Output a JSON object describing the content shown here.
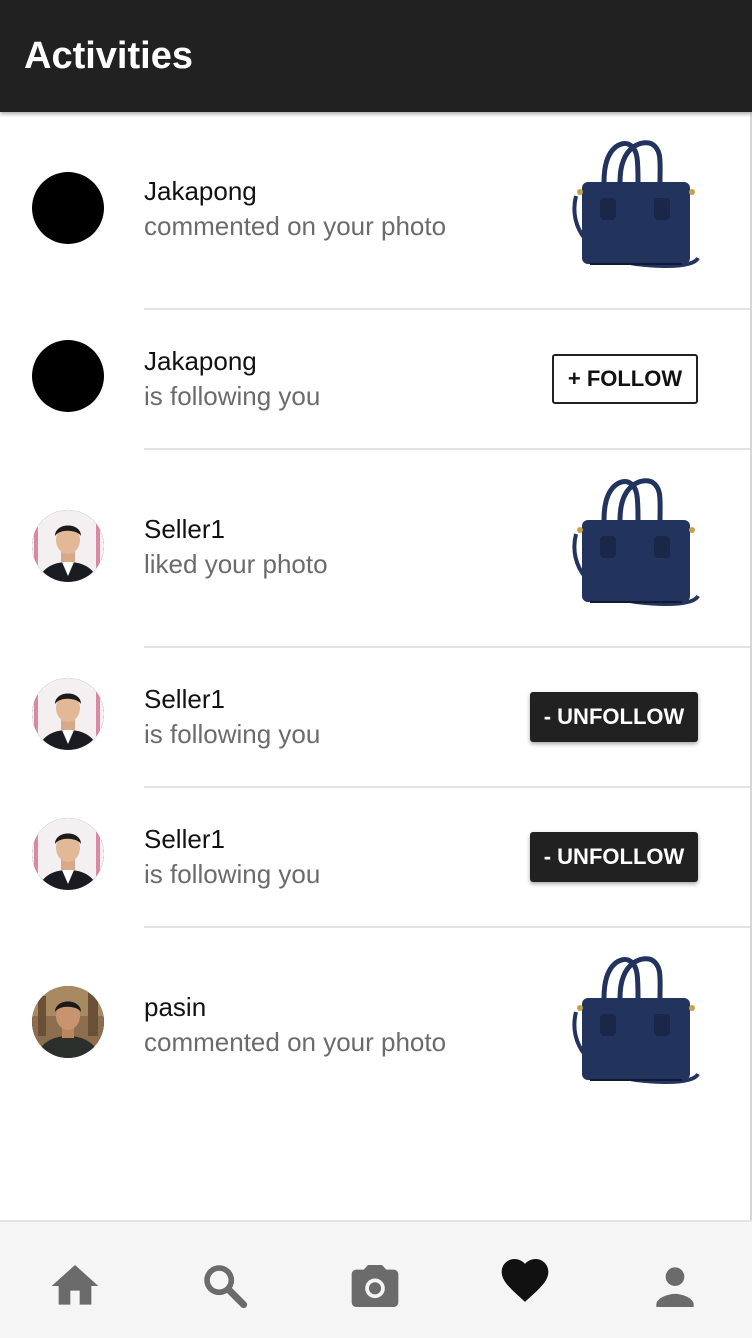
{
  "header": {
    "title": "Activities"
  },
  "activities": [
    {
      "name": "Jakapong",
      "action": "commented on your photo",
      "avatar": "black-avatar",
      "trailing": "photo-thumbnail-bag"
    },
    {
      "name": "Jakapong",
      "action": "is following you",
      "avatar": "black-avatar",
      "trailing": "follow-button",
      "button_label": "+ FOLLOW"
    },
    {
      "name": "Seller1",
      "action": "liked your photo",
      "avatar": "seller1-photo",
      "trailing": "photo-thumbnail-bag"
    },
    {
      "name": "Seller1",
      "action": "is following you",
      "avatar": "seller1-photo",
      "trailing": "unfollow-button",
      "button_label": "- UNFOLLOW"
    },
    {
      "name": "Seller1",
      "action": "is following you",
      "avatar": "seller1-photo",
      "trailing": "unfollow-button",
      "button_label": "- UNFOLLOW"
    },
    {
      "name": "pasin",
      "action": "commented on your photo",
      "avatar": "pasin-photo",
      "trailing": "photo-thumbnail-bag"
    }
  ],
  "bottom_nav": [
    {
      "icon": "home-icon"
    },
    {
      "icon": "search-icon"
    },
    {
      "icon": "camera-icon"
    },
    {
      "icon": "heart-icon",
      "active": true
    },
    {
      "icon": "person-icon"
    }
  ],
  "colors": {
    "app_bar": "#212121",
    "unfollow_button": "#212121",
    "nav_inactive": "#6b6b6b",
    "nav_active": "#111111",
    "bag": "#22335e"
  }
}
